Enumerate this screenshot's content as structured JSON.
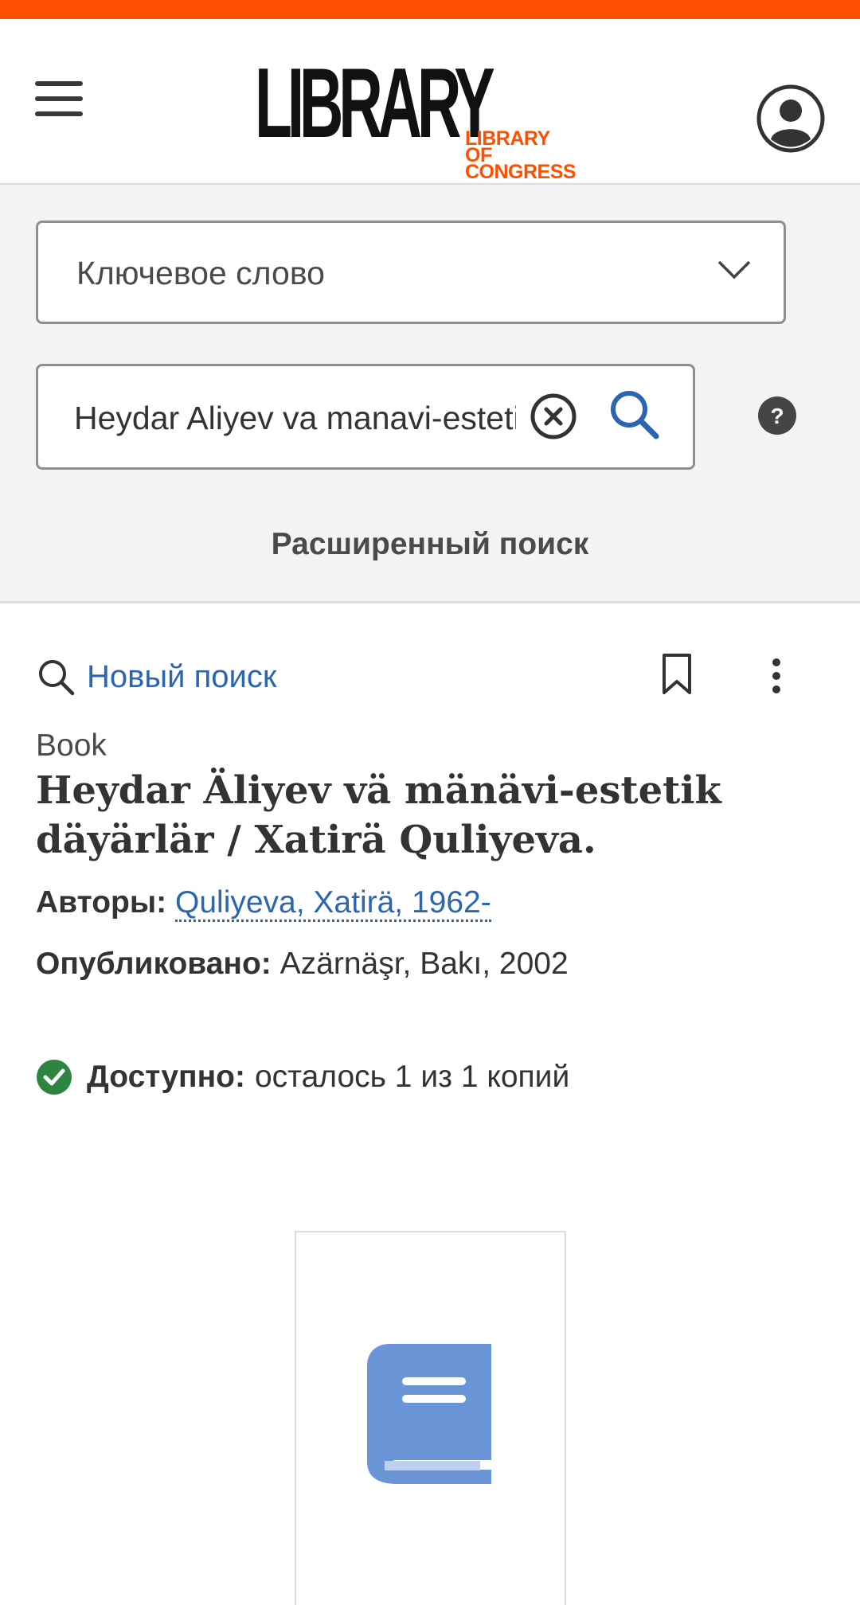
{
  "header": {
    "logo_main": "LIBRARY",
    "logo_sub_line1": "LIBRARY",
    "logo_sub_line2": "OF CONGRESS",
    "menu_icon": "hamburger-menu-icon",
    "user_icon": "user-account-icon"
  },
  "search": {
    "field_type": "Ключевое слово",
    "query_value": "Heydar Aliyev va manavi-estetik",
    "advanced_label": "Расширенный поиск",
    "clear_icon": "clear-circle-x-icon",
    "search_icon": "magnifier-icon",
    "help_icon": "question-mark-icon"
  },
  "toolbar": {
    "new_search_label": "Новый поиск",
    "bookmark_icon": "bookmark-icon",
    "more_icon": "vertical-dots-icon"
  },
  "record": {
    "format": "Book",
    "title": "Heydar Äliyev vä mänävi-estetik däyärlär / Xatirä Quliyeva.",
    "authors_label": "Авторы:",
    "author": "Quliyeva, Xatirä, 1962-",
    "published_label": "Опубликовано:",
    "published": "Azärnäşr, Bakı, 2002",
    "availability_label": "Доступно:",
    "availability": "осталось 1 из 1 копий"
  },
  "colors": {
    "accent": "#ff4f00",
    "link": "#2b66b0",
    "available": "#2e8540",
    "cover_icon": "#6a96d8"
  }
}
